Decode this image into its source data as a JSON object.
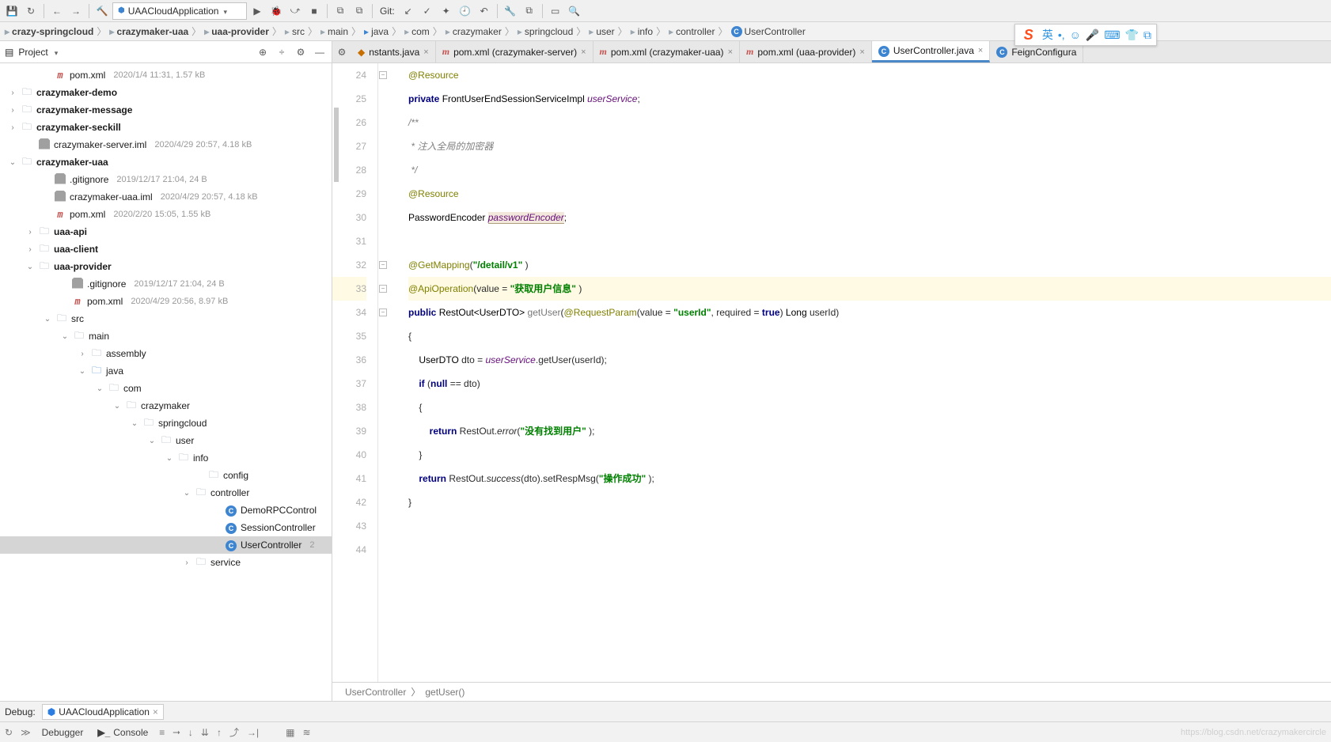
{
  "toolbar": {
    "run_config": "UAACloudApplication",
    "git_label": "Git:"
  },
  "breadcrumbs": [
    {
      "label": "crazy-springcloud",
      "bold": true,
      "icon": "folder"
    },
    {
      "label": "crazymaker-uaa",
      "bold": true,
      "icon": "folder"
    },
    {
      "label": "uaa-provider",
      "bold": true,
      "icon": "folder"
    },
    {
      "label": "src",
      "icon": "folder"
    },
    {
      "label": "main",
      "icon": "folder"
    },
    {
      "label": "java",
      "icon": "folder-blue"
    },
    {
      "label": "com",
      "icon": "folder"
    },
    {
      "label": "crazymaker",
      "icon": "folder"
    },
    {
      "label": "springcloud",
      "icon": "folder"
    },
    {
      "label": "user",
      "icon": "folder"
    },
    {
      "label": "info",
      "icon": "folder"
    },
    {
      "label": "controller",
      "icon": "folder"
    },
    {
      "label": "UserController",
      "icon": "class"
    }
  ],
  "project": {
    "title": "Project",
    "tree": [
      {
        "indent": 52,
        "arrow": "",
        "icon": "m",
        "name": "pom.xml",
        "meta": "2020/1/4 11:31, 1.57 kB"
      },
      {
        "indent": 10,
        "arrow": ">",
        "icon": "folder",
        "name": "crazymaker-demo",
        "bold": true
      },
      {
        "indent": 10,
        "arrow": ">",
        "icon": "folder",
        "name": "crazymaker-message",
        "bold": true
      },
      {
        "indent": 10,
        "arrow": ">",
        "icon": "folder",
        "name": "crazymaker-seckill",
        "bold": true
      },
      {
        "indent": 32,
        "arrow": "",
        "icon": "iml",
        "name": "crazymaker-server.iml",
        "meta": "2020/4/29 20:57, 4.18 kB"
      },
      {
        "indent": 10,
        "arrow": "v",
        "icon": "folder",
        "name": "crazymaker-uaa",
        "bold": true
      },
      {
        "indent": 52,
        "arrow": "",
        "icon": "iml",
        "name": ".gitignore",
        "meta": "2019/12/17 21:04, 24 B"
      },
      {
        "indent": 52,
        "arrow": "",
        "icon": "iml",
        "name": "crazymaker-uaa.iml",
        "meta": "2020/4/29 20:57, 4.18 kB"
      },
      {
        "indent": 52,
        "arrow": "",
        "icon": "m",
        "name": "pom.xml",
        "meta": "2020/2/20 15:05, 1.55 kB"
      },
      {
        "indent": 32,
        "arrow": ">",
        "icon": "folder",
        "name": "uaa-api",
        "bold": true
      },
      {
        "indent": 32,
        "arrow": ">",
        "icon": "folder",
        "name": "uaa-client",
        "bold": true
      },
      {
        "indent": 32,
        "arrow": "v",
        "icon": "folder",
        "name": "uaa-provider",
        "bold": true
      },
      {
        "indent": 74,
        "arrow": "",
        "icon": "iml",
        "name": ".gitignore",
        "meta": "2019/12/17 21:04, 24 B"
      },
      {
        "indent": 74,
        "arrow": "",
        "icon": "m",
        "name": "pom.xml",
        "meta": "2020/4/29 20:56, 8.97 kB"
      },
      {
        "indent": 54,
        "arrow": "v",
        "icon": "folder",
        "name": "src"
      },
      {
        "indent": 76,
        "arrow": "v",
        "icon": "folder",
        "name": "main"
      },
      {
        "indent": 98,
        "arrow": ">",
        "icon": "folder",
        "name": "assembly"
      },
      {
        "indent": 98,
        "arrow": "v",
        "icon": "folder-blue",
        "name": "java"
      },
      {
        "indent": 120,
        "arrow": "v",
        "icon": "folder",
        "name": "com"
      },
      {
        "indent": 142,
        "arrow": "v",
        "icon": "folder",
        "name": "crazymaker"
      },
      {
        "indent": 164,
        "arrow": "v",
        "icon": "folder",
        "name": "springcloud"
      },
      {
        "indent": 186,
        "arrow": "v",
        "icon": "folder",
        "name": "user"
      },
      {
        "indent": 208,
        "arrow": "v",
        "icon": "folder",
        "name": "info"
      },
      {
        "indent": 246,
        "arrow": "",
        "icon": "folder",
        "name": "config"
      },
      {
        "indent": 230,
        "arrow": "v",
        "icon": "folder",
        "name": "controller"
      },
      {
        "indent": 268,
        "arrow": "",
        "icon": "class",
        "name": "DemoRPCControl"
      },
      {
        "indent": 268,
        "arrow": "",
        "icon": "class",
        "name": "SessionController"
      },
      {
        "indent": 268,
        "arrow": "",
        "icon": "class",
        "name": "UserController",
        "meta": "2",
        "sel": true
      },
      {
        "indent": 230,
        "arrow": ">",
        "icon": "folder",
        "name": "service"
      }
    ]
  },
  "tabs": [
    {
      "icon": "j",
      "label": "nstants.java",
      "close": true
    },
    {
      "icon": "m",
      "label": "pom.xml (crazymaker-server)",
      "close": true
    },
    {
      "icon": "m",
      "label": "pom.xml (crazymaker-uaa)",
      "close": true
    },
    {
      "icon": "m",
      "label": "pom.xml (uaa-provider)",
      "close": true
    },
    {
      "icon": "c",
      "label": "UserController.java",
      "close": true,
      "active": true
    },
    {
      "icon": "c",
      "label": "FeignConfigura"
    }
  ],
  "code": {
    "lines": [
      {
        "n": 24,
        "html": "<span class='ann'>@Resource</span>"
      },
      {
        "n": 25,
        "html": "<span class='kw'>private</span> <span class='type'>FrontUserEndSessionServiceImpl</span> <span class='field'>userService</span>;"
      },
      {
        "n": 26,
        "html": "<span class='cmt'>/**</span>"
      },
      {
        "n": 27,
        "html": "<span class='cmt'> * 注入全局的加密器</span>"
      },
      {
        "n": 28,
        "html": "<span class='cmt'> */</span>"
      },
      {
        "n": 29,
        "html": "<span class='ann'>@Resource</span>"
      },
      {
        "n": 30,
        "html": "<span class='type'>PasswordEncoder</span> <span class='field boxed'>passwordEncoder</span>;"
      },
      {
        "n": 31,
        "html": ""
      },
      {
        "n": 32,
        "html": "<span class='ann'>@GetMapping</span>(<span class='str'>\"/detail/v1\"</span> )"
      },
      {
        "n": 33,
        "hl": true,
        "html": "<span class='ann'>@ApiOperation</span>(value = <span class='str'>\"获取用户信息\"</span> )"
      },
      {
        "n": 34,
        "html": "<span class='kw'>public</span> <span class='type'>RestOut&lt;UserDTO&gt;</span> <span class='mgray'>getUser</span>(<span class='ann'>@RequestParam</span>(value = <span class='str'>\"userId\"</span>, required = <span class='kw'>true</span>) <span class='type'>Long</span> userId)"
      },
      {
        "n": 35,
        "html": "{"
      },
      {
        "n": 36,
        "html": "    <span class='type'>UserDTO</span> dto = <span class='field'>userService</span>.getUser(userId);"
      },
      {
        "n": 37,
        "html": "    <span class='kw'>if</span> (<span class='kw'>null</span> == dto)"
      },
      {
        "n": 38,
        "html": "    {"
      },
      {
        "n": 39,
        "html": "        <span class='kw'>return</span> RestOut.<span class='mital'>error</span>(<span class='str'>\"没有找到用户\"</span> );"
      },
      {
        "n": 40,
        "html": "    }"
      },
      {
        "n": 41,
        "html": "    <span class='kw'>return</span> RestOut.<span class='mital'>success</span>(dto).setRespMsg(<span class='str'>\"操作成功\"</span> );"
      },
      {
        "n": 42,
        "html": "}"
      },
      {
        "n": 43,
        "html": ""
      },
      {
        "n": 44,
        "html": ""
      }
    ]
  },
  "crumb_bottom": {
    "a": "UserController",
    "b": "getUser()"
  },
  "debug": {
    "label": "Debug:",
    "config": "UAACloudApplication"
  },
  "bottom": {
    "debugger": "Debugger",
    "console": "Console"
  },
  "watermark": "https://blog.csdn.net/crazymakercircle"
}
